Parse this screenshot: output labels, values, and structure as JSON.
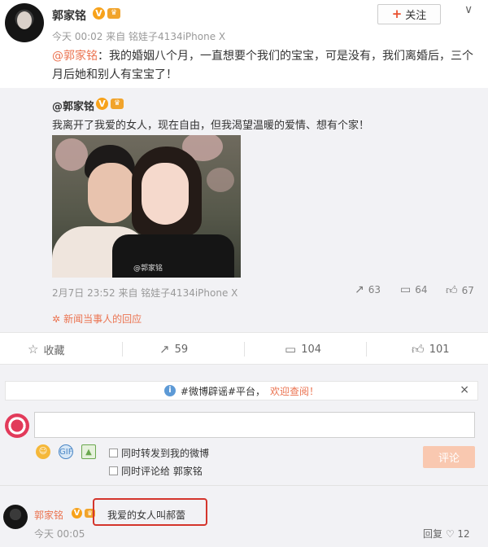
{
  "post": {
    "author": "郭家铭",
    "vip_badge": "V",
    "timestamp": "今天 00:02",
    "source": "来自 铭娃子4134iPhone X",
    "follow_label": "关注",
    "mention": "@郭家铭",
    "colon": "：",
    "text": "我的婚姻八个月，一直想要个我们的宝宝，可是没有，我们离婚后，三个月后她和别人有宝宝了！"
  },
  "repost": {
    "author": "@郭家铭",
    "text": "我离开了我爱的女人，现在自由，但我渴望温暖的爱情、想有个家！",
    "image_watermark": "@郭家铭",
    "meta": "2月7日 23:52 来自 铭娃子4134iPhone X",
    "actions": {
      "forward": "63",
      "comment": "64",
      "like": "67"
    },
    "ack": "新闻当事人的回应"
  },
  "action_bar": {
    "favorite": "收藏",
    "forward": "59",
    "comment": "104",
    "like": "101"
  },
  "comment_box": {
    "notice_prefix": "#微博辟谣#平台，",
    "notice_link": "欢迎查阅！",
    "option_forward": "同时转发到我的微博",
    "option_comment": "同时评论给 郭家铭",
    "submit_label": "评论"
  },
  "comments": [
    {
      "author": "郭家铭",
      "text": "我爱的女人叫郝蕾",
      "time": "今天 00:05",
      "actions_partial": "回复  ♡ 12"
    }
  ],
  "colors": {
    "accent": "#eb7350",
    "highlight_box": "#d4352c",
    "vip": "#f7a21b"
  },
  "icons": [
    "chevron-down-icon",
    "forward-icon",
    "comment-icon",
    "like-icon",
    "star-icon",
    "info-icon",
    "emoji-icon",
    "image-icon"
  ]
}
